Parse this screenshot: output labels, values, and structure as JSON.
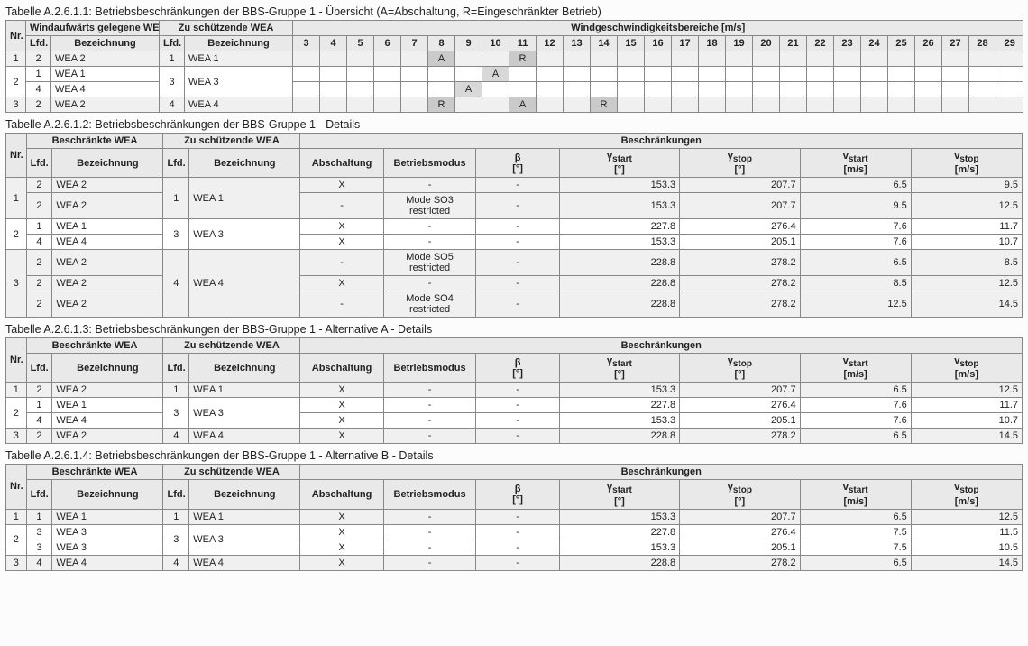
{
  "h": {
    "windauf": "Windaufwärts gelegene WEA",
    "beschr": "Beschränkte WEA",
    "zuschuetz": "Zu schützende WEA",
    "windgesch": "Windgeschwindigkeitsbereiche [m/s]",
    "beschraenk": "Beschränkungen",
    "nr": "Nr.",
    "lfd": "Lfd. Nr.",
    "bez": "Bezeichnung",
    "absch": "Abschaltung",
    "bmod": "Betriebsmodus",
    "beta": "β [°]",
    "gstart": "γ",
    "gstart2": "start",
    "gstart3": " [°]",
    "gstop": "γ",
    "gstop2": "stop",
    "gstop3": " [°]",
    "vstart": "v",
    "vstart2": "start",
    "vstart3": " [m/s]",
    "vstop": "v",
    "vstop2": "stop",
    "vstop3": " [m/s]"
  },
  "ws_cols": [
    "3",
    "4",
    "5",
    "6",
    "7",
    "8",
    "9",
    "10",
    "11",
    "12",
    "13",
    "14",
    "15",
    "16",
    "17",
    "18",
    "19",
    "20",
    "21",
    "22",
    "23",
    "24",
    "25",
    "26",
    "27",
    "28",
    "29"
  ],
  "t1": {
    "caption": "Tabelle A.2.6.1.1: Betriebsbeschränkungen der BBS-Gruppe 1 - Übersicht (A=Abschaltung, R=Eingeschränkter Betrieb)",
    "rows": [
      {
        "nr": "1",
        "lfd1": "2",
        "bez1": "WEA 2",
        "lfd2": "1",
        "bez2": "WEA 1",
        "marks": {
          "8": "A",
          "11": "R"
        }
      },
      {
        "nr": "2",
        "groups": [
          {
            "lfd1": "1",
            "bez1": "WEA 1",
            "marks": {
              "10": "A"
            }
          },
          {
            "lfd1": "4",
            "bez1": "WEA 4",
            "marks": {
              "9": "A"
            }
          }
        ],
        "lfd2": "3",
        "bez2": "WEA 3"
      },
      {
        "nr": "3",
        "lfd1": "2",
        "bez1": "WEA 2",
        "lfd2": "4",
        "bez2": "WEA 4",
        "marks": {
          "8": "R",
          "11": "A",
          "14": "R"
        }
      }
    ]
  },
  "t2": {
    "caption": "Tabelle A.2.6.1.2: Betriebsbeschränkungen der BBS-Gruppe 1 - Details",
    "groups": [
      {
        "nr": "1",
        "lfd2": "1",
        "bez2": "WEA 1",
        "rows": [
          {
            "lfd1": "2",
            "bez1": "WEA 2",
            "ab": "X",
            "bm": "-",
            "beta": "-",
            "gs": "153.3",
            "ge": "207.7",
            "vs": "6.5",
            "ve": "9.5"
          },
          {
            "lfd1": "2",
            "bez1": "WEA 2",
            "ab": "-",
            "bm": "Mode SO3 restricted",
            "beta": "-",
            "gs": "153.3",
            "ge": "207.7",
            "vs": "9.5",
            "ve": "12.5"
          }
        ]
      },
      {
        "nr": "2",
        "lfd2": "3",
        "bez2": "WEA 3",
        "rows": [
          {
            "lfd1": "1",
            "bez1": "WEA 1",
            "ab": "X",
            "bm": "-",
            "beta": "-",
            "gs": "227.8",
            "ge": "276.4",
            "vs": "7.6",
            "ve": "11.7"
          },
          {
            "lfd1": "4",
            "bez1": "WEA 4",
            "ab": "X",
            "bm": "-",
            "beta": "-",
            "gs": "153.3",
            "ge": "205.1",
            "vs": "7.6",
            "ve": "10.7"
          }
        ]
      },
      {
        "nr": "3",
        "lfd2": "4",
        "bez2": "WEA 4",
        "rows": [
          {
            "lfd1": "2",
            "bez1": "WEA 2",
            "ab": "-",
            "bm": "Mode SO5 restricted",
            "beta": "-",
            "gs": "228.8",
            "ge": "278.2",
            "vs": "6.5",
            "ve": "8.5"
          },
          {
            "lfd1": "2",
            "bez1": "WEA 2",
            "ab": "X",
            "bm": "-",
            "beta": "-",
            "gs": "228.8",
            "ge": "278.2",
            "vs": "8.5",
            "ve": "12.5"
          },
          {
            "lfd1": "2",
            "bez1": "WEA 2",
            "ab": "-",
            "bm": "Mode SO4 restricted",
            "beta": "-",
            "gs": "228.8",
            "ge": "278.2",
            "vs": "12.5",
            "ve": "14.5"
          }
        ]
      }
    ]
  },
  "t3": {
    "caption": "Tabelle A.2.6.1.3: Betriebsbeschränkungen der BBS-Gruppe 1 - Alternative A - Details",
    "groups": [
      {
        "nr": "1",
        "lfd2": "1",
        "bez2": "WEA 1",
        "rows": [
          {
            "lfd1": "2",
            "bez1": "WEA 2",
            "ab": "X",
            "bm": "-",
            "beta": "-",
            "gs": "153.3",
            "ge": "207.7",
            "vs": "6.5",
            "ve": "12.5"
          }
        ]
      },
      {
        "nr": "2",
        "lfd2": "3",
        "bez2": "WEA 3",
        "rows": [
          {
            "lfd1": "1",
            "bez1": "WEA 1",
            "ab": "X",
            "bm": "-",
            "beta": "-",
            "gs": "227.8",
            "ge": "276.4",
            "vs": "7.6",
            "ve": "11.7"
          },
          {
            "lfd1": "4",
            "bez1": "WEA 4",
            "ab": "X",
            "bm": "-",
            "beta": "-",
            "gs": "153.3",
            "ge": "205.1",
            "vs": "7.6",
            "ve": "10.7"
          }
        ]
      },
      {
        "nr": "3",
        "lfd2": "4",
        "bez2": "WEA 4",
        "rows": [
          {
            "lfd1": "2",
            "bez1": "WEA 2",
            "ab": "X",
            "bm": "-",
            "beta": "-",
            "gs": "228.8",
            "ge": "278.2",
            "vs": "6.5",
            "ve": "14.5"
          }
        ]
      }
    ]
  },
  "t4": {
    "caption": "Tabelle A.2.6.1.4: Betriebsbeschränkungen der BBS-Gruppe 1 - Alternative B - Details",
    "groups": [
      {
        "nr": "1",
        "lfd2": "1",
        "bez2": "WEA 1",
        "rows": [
          {
            "lfd1": "1",
            "bez1": "WEA 1",
            "ab": "X",
            "bm": "-",
            "beta": "-",
            "gs": "153.3",
            "ge": "207.7",
            "vs": "6.5",
            "ve": "12.5"
          }
        ]
      },
      {
        "nr": "2",
        "lfd2": "3",
        "bez2": "WEA 3",
        "rows": [
          {
            "lfd1": "3",
            "bez1": "WEA 3",
            "ab": "X",
            "bm": "-",
            "beta": "-",
            "gs": "227.8",
            "ge": "276.4",
            "vs": "7.5",
            "ve": "11.5"
          },
          {
            "lfd1": "3",
            "bez1": "WEA 3",
            "ab": "X",
            "bm": "-",
            "beta": "-",
            "gs": "153.3",
            "ge": "205.1",
            "vs": "7.5",
            "ve": "10.5"
          }
        ]
      },
      {
        "nr": "3",
        "lfd2": "4",
        "bez2": "WEA 4",
        "rows": [
          {
            "lfd1": "4",
            "bez1": "WEA 4",
            "ab": "X",
            "bm": "-",
            "beta": "-",
            "gs": "228.8",
            "ge": "278.2",
            "vs": "6.5",
            "ve": "14.5"
          }
        ]
      }
    ]
  }
}
